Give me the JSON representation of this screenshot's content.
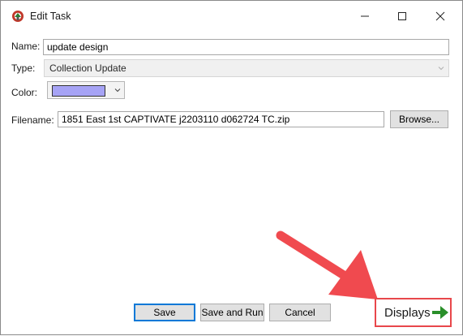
{
  "window": {
    "title": "Edit Task"
  },
  "form": {
    "name_label": "Name:",
    "name_value": "update design",
    "type_label": "Type:",
    "type_value": "Collection Update",
    "color_label": "Color:",
    "color_value": "#a6a3f5",
    "filename_label": "Filename:",
    "filename_value": "1851 East 1st CAPTIVATE j2203110 d062724 TC.zip",
    "browse_label": "Browse..."
  },
  "buttons": {
    "save_label": "Save",
    "save_run_label": "Save and Run",
    "cancel_label": "Cancel"
  },
  "annotation": {
    "callout_text": "Displays",
    "arrow_color": "#f04a4f",
    "callout_arrow_color": "#2a8f2a"
  }
}
